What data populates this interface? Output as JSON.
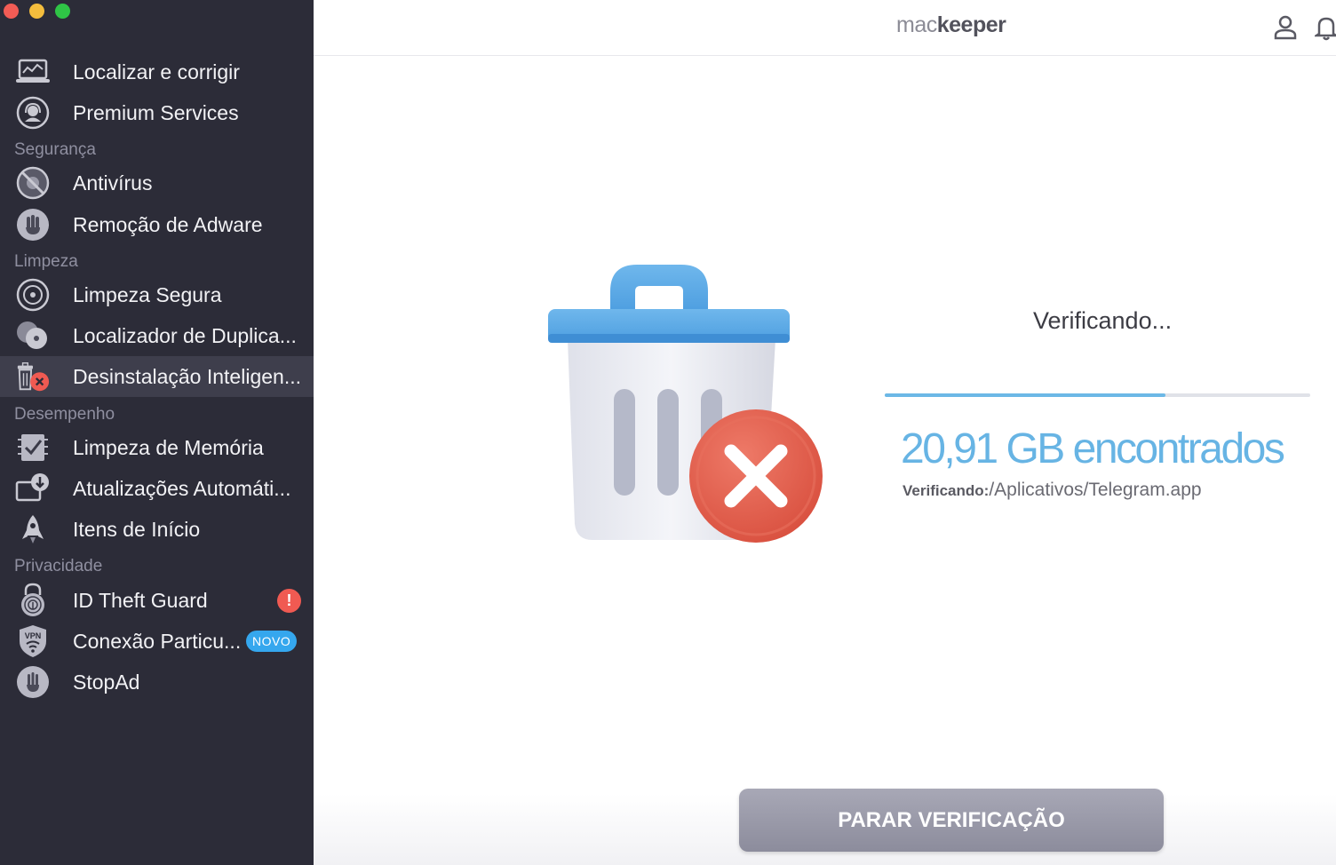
{
  "colors": {
    "sidebar_bg": "#2c2c38",
    "sidebar_active": "#3e3e4c",
    "accent_blue": "#67b4e4",
    "alert_red": "#f05a52",
    "new_badge": "#35a7ee",
    "button_gray": "#9a9aa8"
  },
  "sidebar": {
    "top_items": [
      {
        "label": "Localizar e corrigir",
        "icon": "laptop-chart-icon"
      },
      {
        "label": "Premium Services",
        "icon": "headset-icon"
      }
    ],
    "sections": {
      "security": {
        "title": "Segurança",
        "items": [
          {
            "label": "Antivírus",
            "icon": "virus-block-icon"
          },
          {
            "label": "Remoção de Adware",
            "icon": "hand-stop-icon"
          }
        ]
      },
      "cleaning": {
        "title": "Limpeza",
        "items": [
          {
            "label": "Limpeza Segura",
            "icon": "disk-clean-icon"
          },
          {
            "label": "Localizador de Duplica...",
            "icon": "duplicate-discs-icon"
          },
          {
            "label": "Desinstalação Inteligen...",
            "icon": "trash-uninstall-icon",
            "active": true
          }
        ]
      },
      "performance": {
        "title": "Desempenho",
        "items": [
          {
            "label": "Limpeza de Memória",
            "icon": "memory-check-icon"
          },
          {
            "label": "Atualizações Automáti...",
            "icon": "download-update-icon"
          },
          {
            "label": "Itens de Início",
            "icon": "rocket-icon"
          }
        ]
      },
      "privacy": {
        "title": "Privacidade",
        "items": [
          {
            "label": "ID Theft Guard",
            "icon": "fingerprint-lock-icon",
            "badge": "!"
          },
          {
            "label": "Conexão Particu...",
            "icon": "vpn-shield-icon",
            "badge": "NOVO"
          },
          {
            "label": "StopAd",
            "icon": "stop-hand-icon"
          }
        ]
      }
    }
  },
  "header": {
    "logo_part1": "mac",
    "logo_part2": "keeper"
  },
  "scan": {
    "title": "Verificando...",
    "progress": 0.66,
    "found_text": "20,91 GB encontrados",
    "current_label": "Verificando:",
    "current_path": "/Aplicativos/Telegram.app",
    "stop_button": "PARAR VERIFICAÇÃO"
  }
}
